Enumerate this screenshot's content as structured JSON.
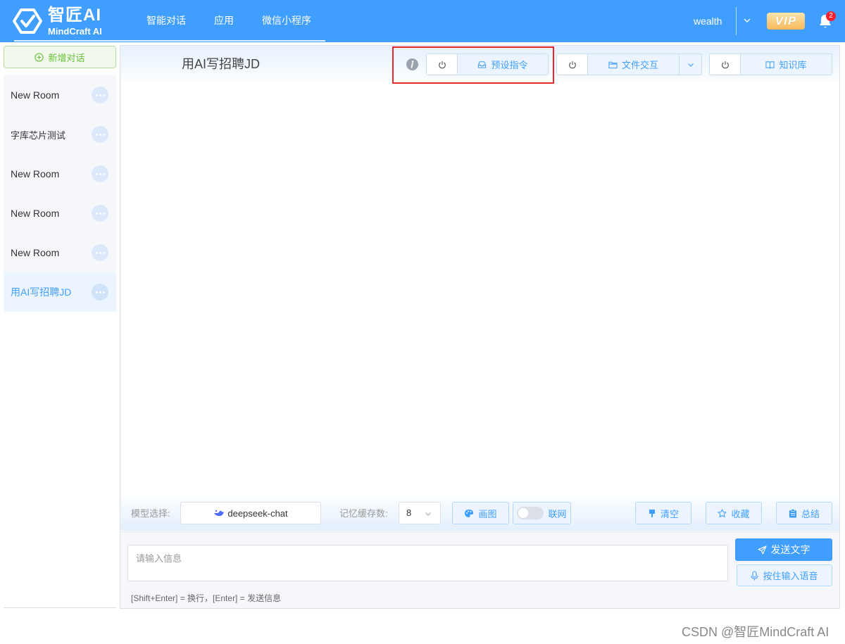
{
  "header": {
    "logo_cn": "智匠AI",
    "logo_en": "MindCraft AI",
    "nav": [
      "智能对话",
      "应用",
      "微信小程序"
    ],
    "user": "wealth",
    "vip": "VIP",
    "notification_count": "2",
    "brand_color": "#409eff"
  },
  "sidebar": {
    "new_chat": "新增对话",
    "rooms": [
      {
        "label": "New Room"
      },
      {
        "label": "字库芯片测试"
      },
      {
        "label": "New Room"
      },
      {
        "label": "New Room"
      },
      {
        "label": "New Room"
      },
      {
        "label": "用AI写招聘JD",
        "active": true
      }
    ]
  },
  "chat": {
    "title": "用AI写招聘JD",
    "preset_label": "预设指令",
    "file_label": "文件交互",
    "kb_label": "知识库"
  },
  "toolbar": {
    "model_label": "模型选择:",
    "model_value": "deepseek-chat",
    "memory_label": "记忆缓存数:",
    "memory_value": "8",
    "draw_label": "画图",
    "web_label": "联网",
    "web_enabled": false,
    "clear_label": "清空",
    "fav_label": "收藏",
    "summary_label": "总结"
  },
  "input": {
    "placeholder": "请输入信息",
    "send_label": "发送文字",
    "voice_label": "按住输入语音",
    "hint": "[Shift+Enter] = 换行，[Enter] = 发送信息"
  },
  "watermark": "CSDN @智匠MindCraft AI"
}
